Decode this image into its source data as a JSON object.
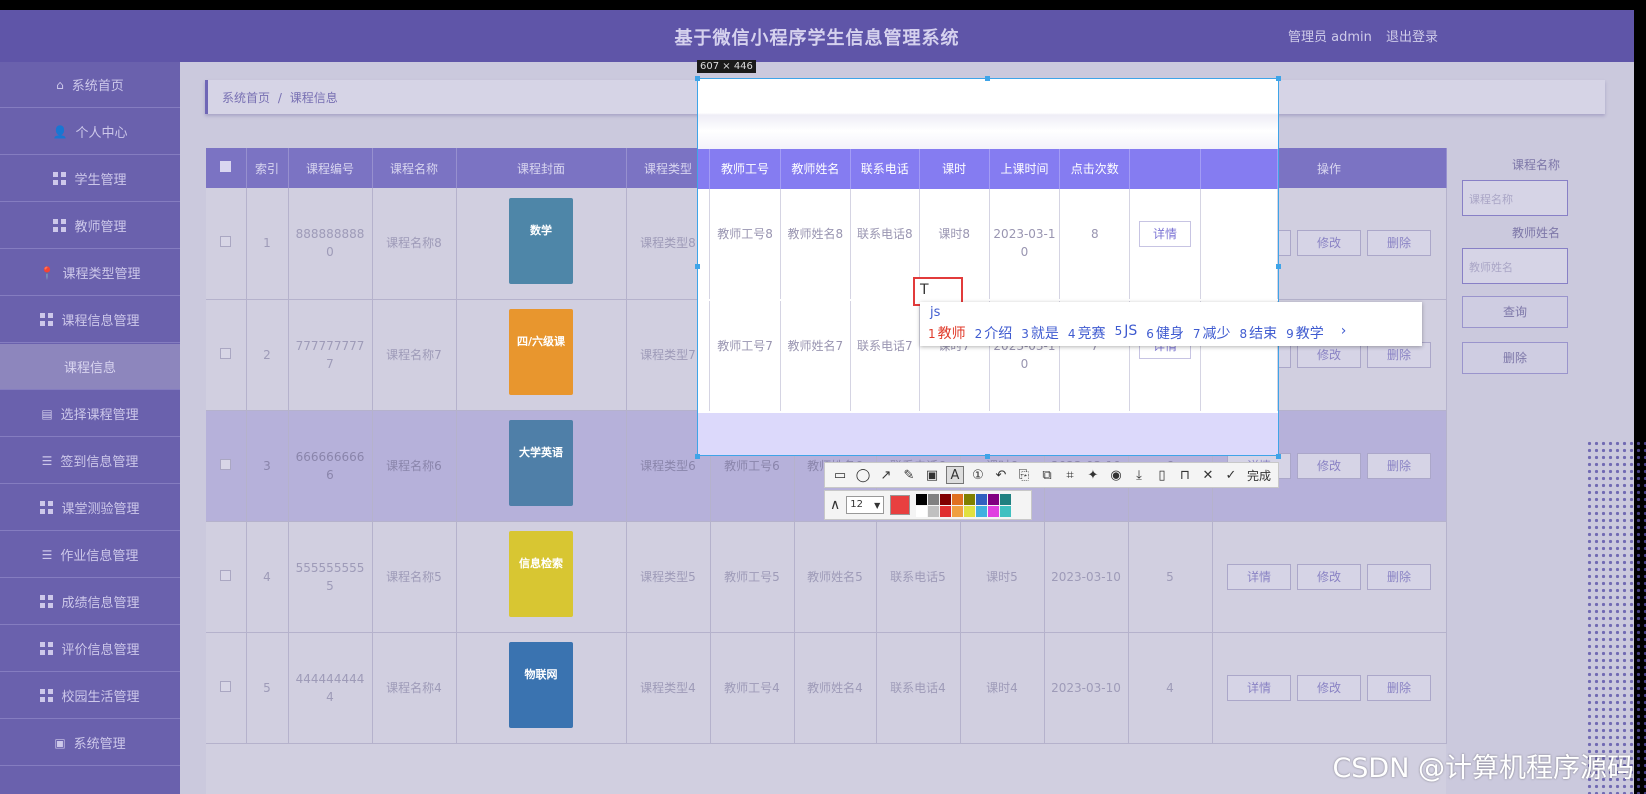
{
  "app": {
    "title": "基于微信小程序学生信息管理系统",
    "user_label": "管理员 admin",
    "logout_label": "退出登录"
  },
  "sidebar": {
    "items": [
      {
        "label": "系统首页",
        "icon": "home-icon"
      },
      {
        "label": "个人中心",
        "icon": "user-icon"
      },
      {
        "label": "学生管理",
        "icon": "grid-icon"
      },
      {
        "label": "教师管理",
        "icon": "grid-icon"
      },
      {
        "label": "课程类型管理",
        "icon": "pin-icon"
      },
      {
        "label": "课程信息管理",
        "icon": "grid-icon"
      },
      {
        "label": "课程信息",
        "icon": ""
      },
      {
        "label": "选择课程管理",
        "icon": "clipboard-icon"
      },
      {
        "label": "签到信息管理",
        "icon": "list-icon"
      },
      {
        "label": "课堂测验管理",
        "icon": "grid-icon"
      },
      {
        "label": "作业信息管理",
        "icon": "list-icon"
      },
      {
        "label": "成绩信息管理",
        "icon": "grid-icon"
      },
      {
        "label": "评价信息管理",
        "icon": "grid-icon"
      },
      {
        "label": "校园生活管理",
        "icon": "grid-icon"
      },
      {
        "label": "系统管理",
        "icon": "briefcase-icon"
      }
    ]
  },
  "breadcrumb": {
    "home": "系统首页",
    "sep": "/",
    "current": "课程信息"
  },
  "table": {
    "headers": [
      "",
      "索引",
      "课程编号",
      "课程名称",
      "课程封面",
      "课程类型",
      "教师工号",
      "教师姓名",
      "联系电话",
      "课时",
      "上课时间",
      "点击次数",
      "操作"
    ],
    "rows": [
      {
        "index": "1",
        "code": "8888888880",
        "name": "课程名称8",
        "type": "课程类型8",
        "tno": "教师工号8",
        "tname": "教师姓名8",
        "phone": "联系电话8",
        "hours": "课时8",
        "time": "2023-03-10",
        "clicks": "8",
        "cover_color": "#4e86a8",
        "cover_text": "数学"
      },
      {
        "index": "2",
        "code": "7777777777",
        "name": "课程名称7",
        "type": "课程类型7",
        "tno": "教师工号7",
        "tname": "教师姓名7",
        "phone": "联系电话7",
        "hours": "课时7",
        "time": "2023-03-10",
        "clicks": "7",
        "cover_color": "#e8962e",
        "cover_text": "四/六级课"
      },
      {
        "index": "3",
        "code": "6666666666",
        "name": "课程名称6",
        "type": "课程类型6",
        "tno": "教师工号6",
        "tname": "教师姓名6",
        "phone": "联系电话6",
        "hours": "课时6",
        "time": "2023-03-10",
        "clicks": "6",
        "cover_color": "#4f7fa8",
        "cover_text": "大学英语"
      },
      {
        "index": "4",
        "code": "5555555555",
        "name": "课程名称5",
        "type": "课程类型5",
        "tno": "教师工号5",
        "tname": "教师姓名5",
        "phone": "联系电话5",
        "hours": "课时5",
        "time": "2023-03-10",
        "clicks": "5",
        "cover_color": "#d8c632",
        "cover_text": "信息检索"
      },
      {
        "index": "5",
        "code": "4444444444",
        "name": "课程名称4",
        "type": "课程类型4",
        "tno": "教师工号4",
        "tname": "教师姓名4",
        "phone": "联系电话4",
        "hours": "课时4",
        "time": "2023-03-10",
        "clicks": "4",
        "cover_color": "#3a73b0",
        "cover_text": "物联网"
      }
    ],
    "btn_detail": "详情",
    "btn_edit": "修改",
    "btn_delete": "删除"
  },
  "search": {
    "course_name_label": "课程名称",
    "course_name_placeholder": "课程名称",
    "teacher_name_label": "教师姓名",
    "teacher_name_placeholder": "教师姓名",
    "query_button": "查询",
    "delete_button": "删除"
  },
  "capture": {
    "size_label": "607 × 446",
    "text_cursor": "T"
  },
  "ime": {
    "input": "js",
    "candidates": [
      {
        "num": "1",
        "text": "教师"
      },
      {
        "num": "2",
        "text": "介绍"
      },
      {
        "num": "3",
        "text": "就是"
      },
      {
        "num": "4",
        "text": "竞赛"
      },
      {
        "num": "5",
        "text": "JS"
      },
      {
        "num": "6",
        "text": "健身"
      },
      {
        "num": "7",
        "text": "减少"
      },
      {
        "num": "8",
        "text": "结束"
      },
      {
        "num": "9",
        "text": "教学"
      }
    ],
    "next": "›"
  },
  "toolbar": {
    "done_label": "完成",
    "font_size": "12",
    "current_color": "#e84040",
    "palette": [
      "#000000",
      "#808080",
      "#800000",
      "#e07020",
      "#808000",
      "#3060c0",
      "#800080",
      "#208080",
      "#ffffff",
      "#c0c0c0",
      "#e03030",
      "#f0a040",
      "#e0e040",
      "#40b0e0",
      "#e040e0",
      "#40c0c0"
    ]
  },
  "watermark": "CSDN @计算机程序源码"
}
